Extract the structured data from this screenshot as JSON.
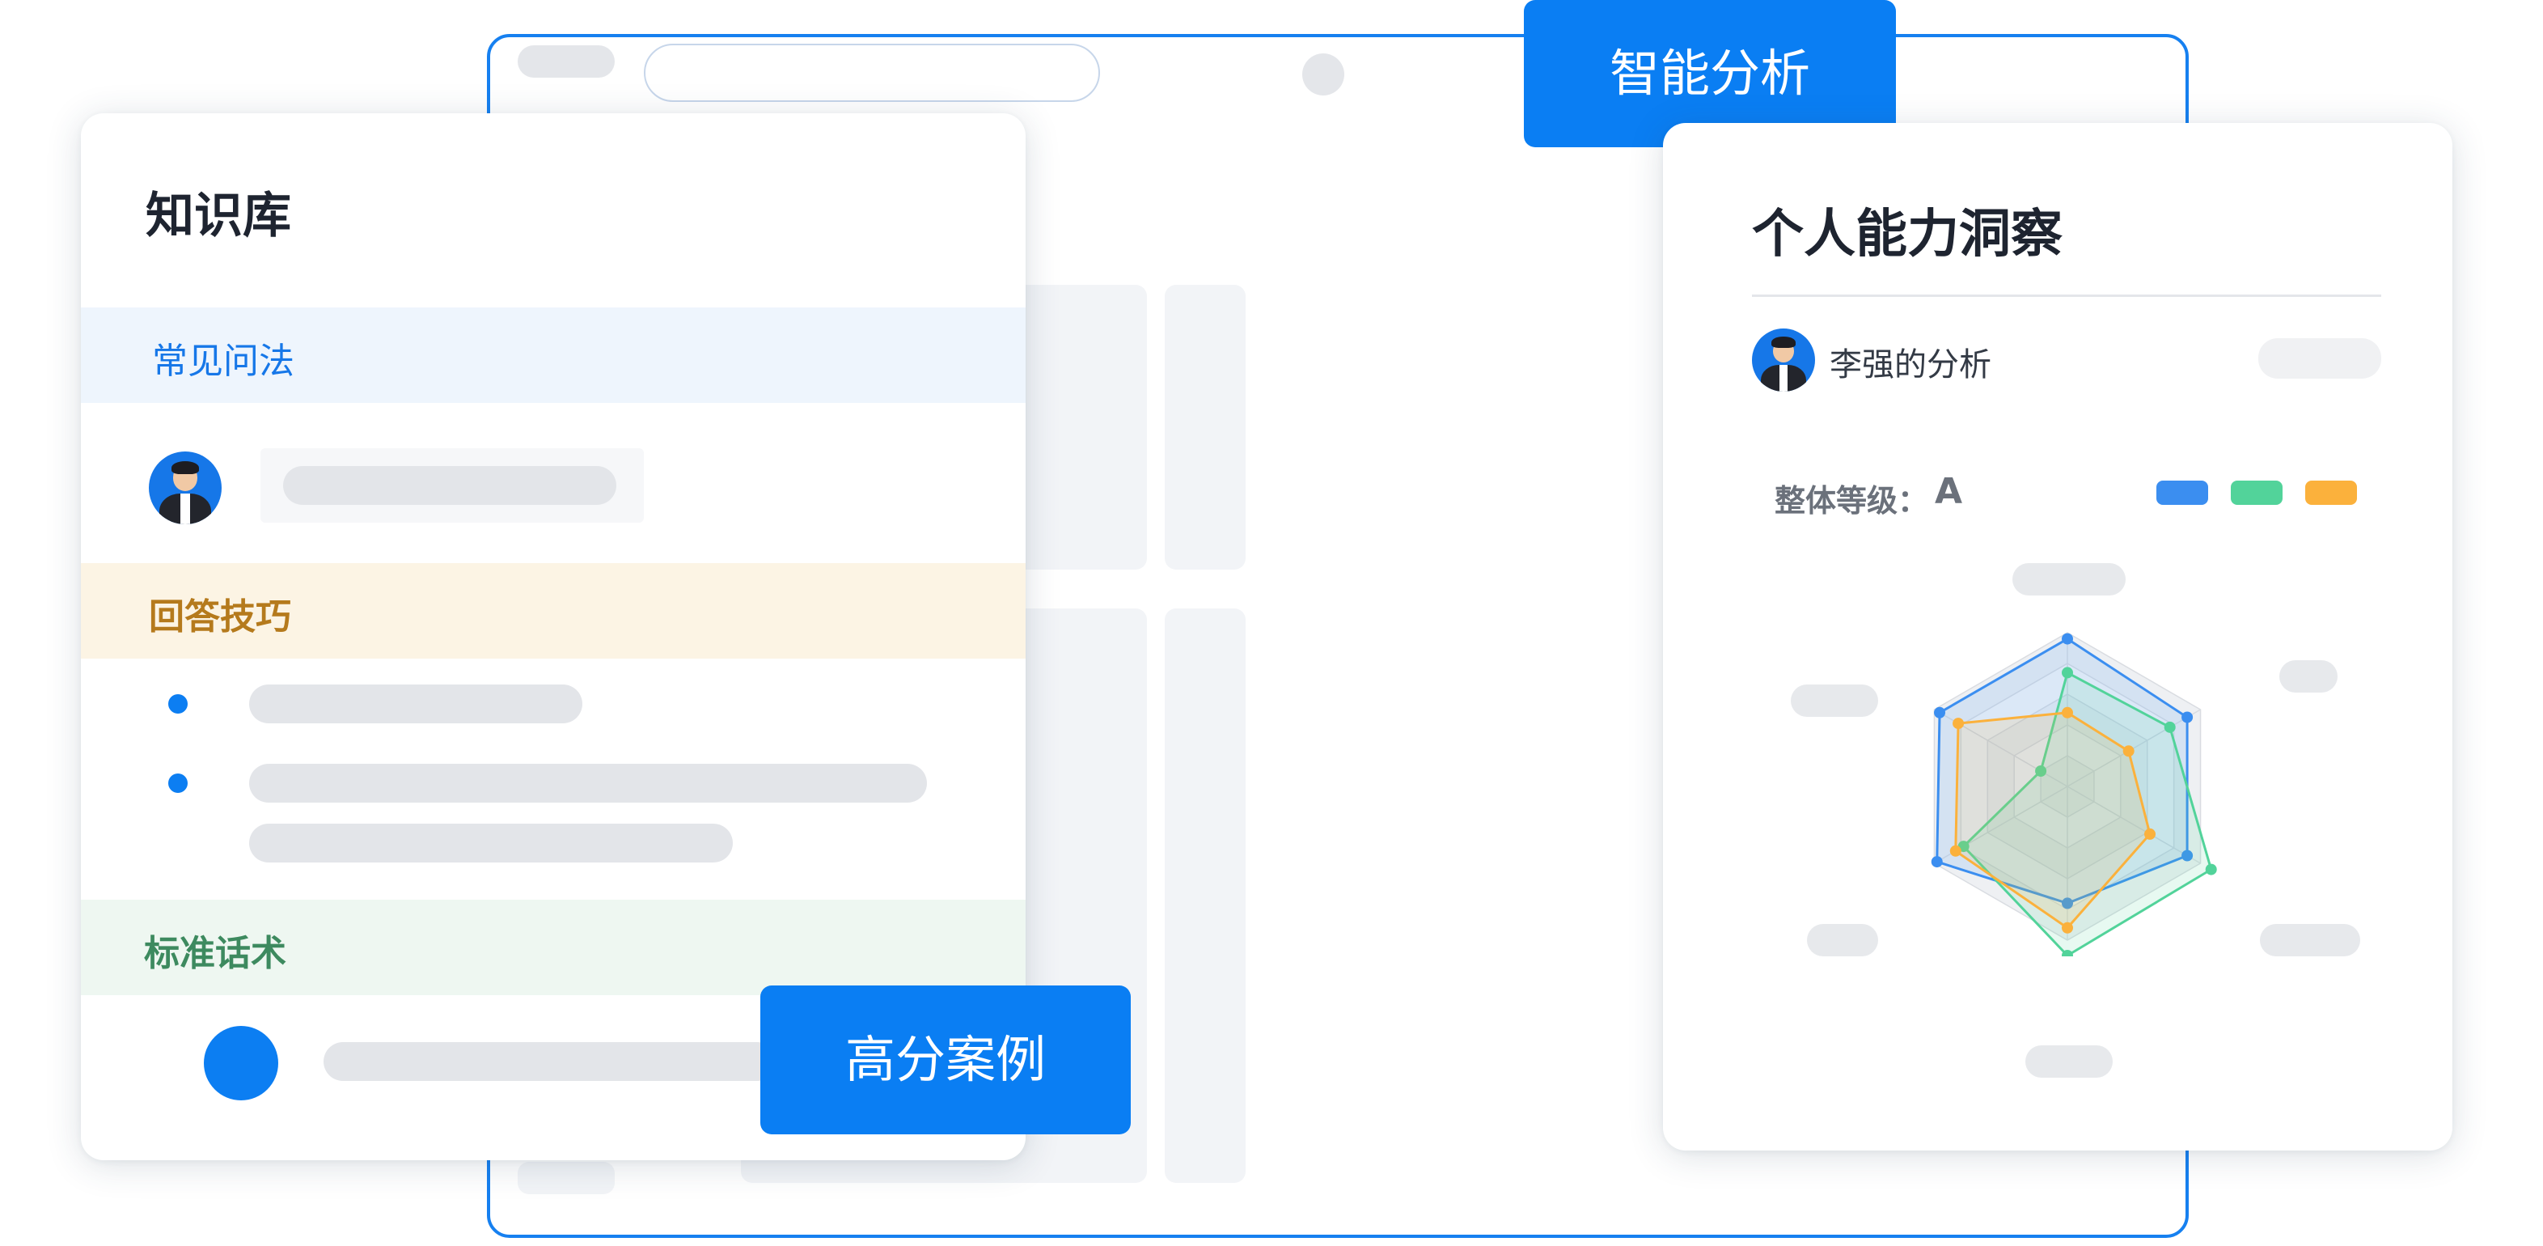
{
  "knowledge_card": {
    "title": "知识库",
    "sections": {
      "faq": "常见问法",
      "tips": "回答技巧",
      "standard": "标准话术"
    }
  },
  "analysis_card": {
    "title": "个人能力洞察",
    "user_analysis": "李强的分析",
    "grade_label": "整体等级：",
    "grade_value": "A",
    "legend_colors": [
      "#3b8ef0",
      "#52d39a",
      "#fbb13c"
    ],
    "radar": {
      "axes": 6,
      "max": 1.0,
      "series": [
        {
          "color": "#3b8ef0",
          "values": [
            0.96,
            0.9,
            0.9,
            0.76,
            0.98,
            0.96
          ]
        },
        {
          "color": "#52d39a",
          "values": [
            0.74,
            0.77,
            1.08,
            1.1,
            0.78,
            0.2
          ]
        },
        {
          "color": "#fbb13c",
          "values": [
            0.48,
            0.46,
            0.62,
            0.92,
            0.84,
            0.82
          ]
        }
      ]
    }
  },
  "badges": {
    "smart_analysis": "智能分析",
    "high_score_cases": "高分案例"
  },
  "colors": {
    "brand_blue": "#0a7ef3",
    "faq_bg": "#eef5fd",
    "tips_bg": "#fcf4e4",
    "standard_bg": "#eef7f1"
  }
}
